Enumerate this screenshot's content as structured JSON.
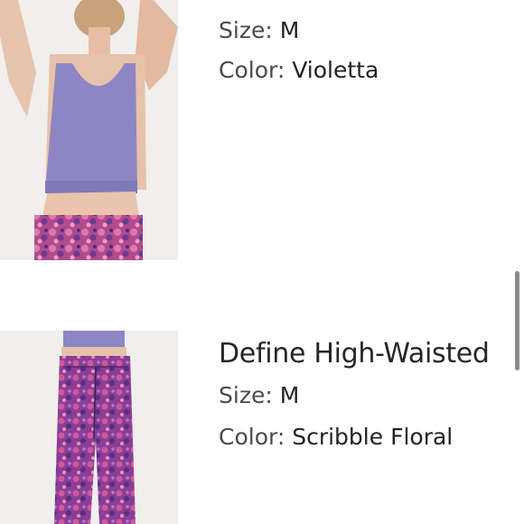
{
  "items": [
    {
      "title": "",
      "size_label": "Size:",
      "size_value": "M",
      "color_label": "Color:",
      "color_value": "Violetta",
      "image_icon": "product-photo-sports-bra"
    },
    {
      "title": "Define High-Waisted",
      "size_label": "Size:",
      "size_value": "M",
      "color_label": "Color:",
      "color_value": "Scribble Floral",
      "image_icon": "product-photo-leggings"
    }
  ],
  "colors": {
    "background": "#ffffff",
    "text": "#2b2b2b",
    "scrollbar": "#8a8a8a",
    "photo_bg": "#eeeeee",
    "bra": "#8e86c4",
    "floral_purple": "#7a3f8e",
    "floral_pink": "#d0589a"
  }
}
